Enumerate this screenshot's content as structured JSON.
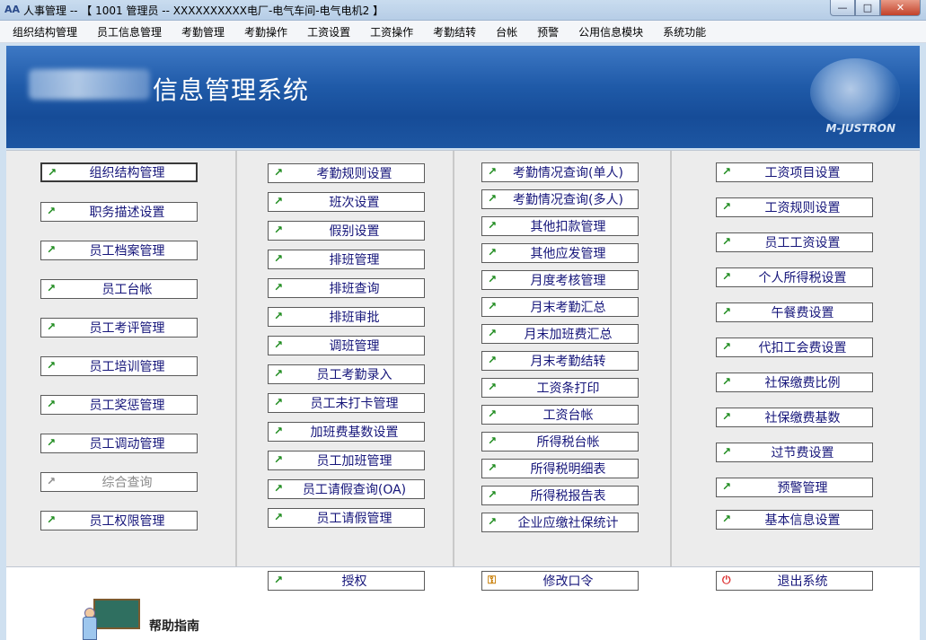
{
  "window": {
    "title": "人事管理 -- 【 1001 管理员 -- XXXXXXXXXX电厂-电气车间-电气电机2 】",
    "app_icon": "AA",
    "controls": {
      "minimize": "—",
      "maximize": "□",
      "close": "✕"
    }
  },
  "menu": [
    "组织结构管理",
    "员工信息管理",
    "考勤管理",
    "考勤操作",
    "工资设置",
    "工资操作",
    "考勤结转",
    "台帐",
    "预警",
    "公用信息模块",
    "系统功能"
  ],
  "banner": {
    "system_title": "信息管理系统",
    "logo_text": "M-JUSTRON"
  },
  "columns": {
    "col1": [
      "组织结构管理",
      "职务描述设置",
      "员工档案管理",
      "员工台帐",
      "员工考评管理",
      "员工培训管理",
      "员工奖惩管理",
      "员工调动管理",
      "综合查询",
      "员工权限管理"
    ],
    "col2": [
      "考勤规则设置",
      "班次设置",
      "假别设置",
      "排班管理",
      "排班查询",
      "排班审批",
      "调班管理",
      "员工考勤录入",
      "员工未打卡管理",
      "加班费基数设置",
      "员工加班管理",
      "员工请假查询(OA)",
      "员工请假管理"
    ],
    "col3": [
      "考勤情况查询(单人)",
      "考勤情况查询(多人)",
      "其他扣款管理",
      "其他应发管理",
      "月度考核管理",
      "月末考勤汇总",
      "月末加班费汇总",
      "月末考勤结转",
      "工资条打印",
      "工资台帐",
      "所得税台帐",
      "所得税明细表",
      "所得税报告表",
      "企业应缴社保统计"
    ],
    "col4": [
      "工资项目设置",
      "工资规则设置",
      "员工工资设置",
      "个人所得税设置",
      "午餐费设置",
      "代扣工会费设置",
      "社保缴费比例",
      "社保缴费基数",
      "过节费设置",
      "预警管理",
      "基本信息设置"
    ]
  },
  "arrow_glyph": "↗",
  "bottom": {
    "authorize": "授权",
    "change_password": "修改口令",
    "exit": "退出系统",
    "help": "帮助指南",
    "key_glyph": "⚿",
    "power_glyph": "⏻"
  },
  "colors": {
    "banner_blue": "#1f5aa8",
    "button_text": "#15157a",
    "arrow_green": "#1b8a1b"
  }
}
